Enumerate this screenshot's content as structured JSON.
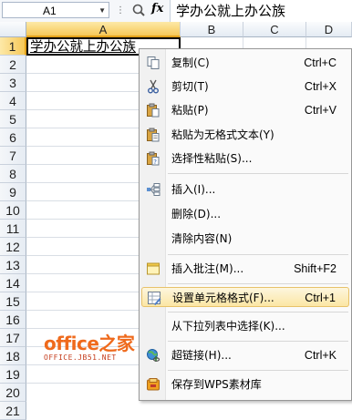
{
  "formula_bar": {
    "cell_ref": "A1",
    "formula_text": "学办公就上办公族",
    "fx_label": "fx"
  },
  "columns": [
    "A",
    "B",
    "C",
    "D"
  ],
  "rows": [
    "1",
    "2",
    "3",
    "4",
    "5",
    "6",
    "7",
    "8",
    "9",
    "10",
    "11",
    "12",
    "13",
    "14",
    "15",
    "16",
    "17",
    "18",
    "19",
    "20",
    "21"
  ],
  "cells": {
    "A1": "学办公就上办公族"
  },
  "context_menu": {
    "items": [
      {
        "label": "复制(C)",
        "shortcut": "Ctrl+C",
        "icon": "copy-icon"
      },
      {
        "label": "剪切(T)",
        "shortcut": "Ctrl+X",
        "icon": "scissors-icon"
      },
      {
        "label": "粘贴(P)",
        "shortcut": "Ctrl+V",
        "icon": "paste-icon"
      },
      {
        "label": "粘贴为无格式文本(Y)",
        "shortcut": "",
        "icon": "paste-plain-icon"
      },
      {
        "label": "选择性粘贴(S)...",
        "shortcut": "",
        "icon": "paste-special-icon"
      },
      {
        "label": "插入(I)...",
        "shortcut": "",
        "icon": "insert-icon"
      },
      {
        "label": "删除(D)...",
        "shortcut": "",
        "icon": ""
      },
      {
        "label": "清除内容(N)",
        "shortcut": "",
        "icon": ""
      },
      {
        "label": "插入批注(M)...",
        "shortcut": "Shift+F2",
        "icon": "comment-icon"
      },
      {
        "label": "设置单元格格式(F)...",
        "shortcut": "Ctrl+1",
        "icon": "format-cells-icon"
      },
      {
        "label": "从下拉列表中选择(K)...",
        "shortcut": "",
        "icon": ""
      },
      {
        "label": "超链接(H)...",
        "shortcut": "Ctrl+K",
        "icon": "hyperlink-icon"
      },
      {
        "label": "保存到WPS素材库",
        "shortcut": "",
        "icon": "save-library-icon"
      }
    ]
  },
  "watermark": {
    "brand": "office之家",
    "domain": "OFFICE.JB51.NET"
  },
  "colors": {
    "selection": "#f6c858",
    "highlight_border": "#e7c26a",
    "watermark": "#ef6a1c"
  }
}
